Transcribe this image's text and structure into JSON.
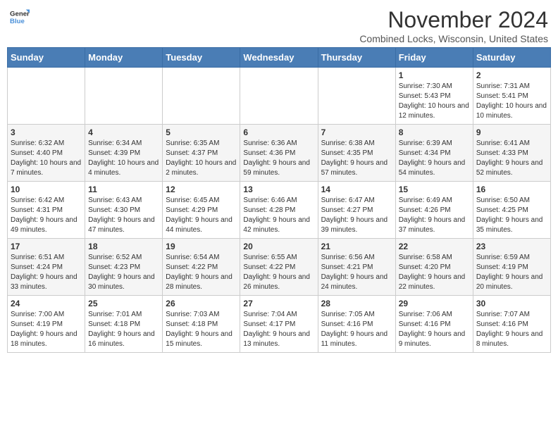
{
  "header": {
    "logo_line1": "General",
    "logo_line2": "Blue",
    "month_year": "November 2024",
    "location": "Combined Locks, Wisconsin, United States"
  },
  "days_of_week": [
    "Sunday",
    "Monday",
    "Tuesday",
    "Wednesday",
    "Thursday",
    "Friday",
    "Saturday"
  ],
  "weeks": [
    [
      {
        "day": "",
        "info": ""
      },
      {
        "day": "",
        "info": ""
      },
      {
        "day": "",
        "info": ""
      },
      {
        "day": "",
        "info": ""
      },
      {
        "day": "",
        "info": ""
      },
      {
        "day": "1",
        "info": "Sunrise: 7:30 AM\nSunset: 5:43 PM\nDaylight: 10 hours and 12 minutes."
      },
      {
        "day": "2",
        "info": "Sunrise: 7:31 AM\nSunset: 5:41 PM\nDaylight: 10 hours and 10 minutes."
      }
    ],
    [
      {
        "day": "3",
        "info": "Sunrise: 6:32 AM\nSunset: 4:40 PM\nDaylight: 10 hours and 7 minutes."
      },
      {
        "day": "4",
        "info": "Sunrise: 6:34 AM\nSunset: 4:39 PM\nDaylight: 10 hours and 4 minutes."
      },
      {
        "day": "5",
        "info": "Sunrise: 6:35 AM\nSunset: 4:37 PM\nDaylight: 10 hours and 2 minutes."
      },
      {
        "day": "6",
        "info": "Sunrise: 6:36 AM\nSunset: 4:36 PM\nDaylight: 9 hours and 59 minutes."
      },
      {
        "day": "7",
        "info": "Sunrise: 6:38 AM\nSunset: 4:35 PM\nDaylight: 9 hours and 57 minutes."
      },
      {
        "day": "8",
        "info": "Sunrise: 6:39 AM\nSunset: 4:34 PM\nDaylight: 9 hours and 54 minutes."
      },
      {
        "day": "9",
        "info": "Sunrise: 6:41 AM\nSunset: 4:33 PM\nDaylight: 9 hours and 52 minutes."
      }
    ],
    [
      {
        "day": "10",
        "info": "Sunrise: 6:42 AM\nSunset: 4:31 PM\nDaylight: 9 hours and 49 minutes."
      },
      {
        "day": "11",
        "info": "Sunrise: 6:43 AM\nSunset: 4:30 PM\nDaylight: 9 hours and 47 minutes."
      },
      {
        "day": "12",
        "info": "Sunrise: 6:45 AM\nSunset: 4:29 PM\nDaylight: 9 hours and 44 minutes."
      },
      {
        "day": "13",
        "info": "Sunrise: 6:46 AM\nSunset: 4:28 PM\nDaylight: 9 hours and 42 minutes."
      },
      {
        "day": "14",
        "info": "Sunrise: 6:47 AM\nSunset: 4:27 PM\nDaylight: 9 hours and 39 minutes."
      },
      {
        "day": "15",
        "info": "Sunrise: 6:49 AM\nSunset: 4:26 PM\nDaylight: 9 hours and 37 minutes."
      },
      {
        "day": "16",
        "info": "Sunrise: 6:50 AM\nSunset: 4:25 PM\nDaylight: 9 hours and 35 minutes."
      }
    ],
    [
      {
        "day": "17",
        "info": "Sunrise: 6:51 AM\nSunset: 4:24 PM\nDaylight: 9 hours and 33 minutes."
      },
      {
        "day": "18",
        "info": "Sunrise: 6:52 AM\nSunset: 4:23 PM\nDaylight: 9 hours and 30 minutes."
      },
      {
        "day": "19",
        "info": "Sunrise: 6:54 AM\nSunset: 4:22 PM\nDaylight: 9 hours and 28 minutes."
      },
      {
        "day": "20",
        "info": "Sunrise: 6:55 AM\nSunset: 4:22 PM\nDaylight: 9 hours and 26 minutes."
      },
      {
        "day": "21",
        "info": "Sunrise: 6:56 AM\nSunset: 4:21 PM\nDaylight: 9 hours and 24 minutes."
      },
      {
        "day": "22",
        "info": "Sunrise: 6:58 AM\nSunset: 4:20 PM\nDaylight: 9 hours and 22 minutes."
      },
      {
        "day": "23",
        "info": "Sunrise: 6:59 AM\nSunset: 4:19 PM\nDaylight: 9 hours and 20 minutes."
      }
    ],
    [
      {
        "day": "24",
        "info": "Sunrise: 7:00 AM\nSunset: 4:19 PM\nDaylight: 9 hours and 18 minutes."
      },
      {
        "day": "25",
        "info": "Sunrise: 7:01 AM\nSunset: 4:18 PM\nDaylight: 9 hours and 16 minutes."
      },
      {
        "day": "26",
        "info": "Sunrise: 7:03 AM\nSunset: 4:18 PM\nDaylight: 9 hours and 15 minutes."
      },
      {
        "day": "27",
        "info": "Sunrise: 7:04 AM\nSunset: 4:17 PM\nDaylight: 9 hours and 13 minutes."
      },
      {
        "day": "28",
        "info": "Sunrise: 7:05 AM\nSunset: 4:16 PM\nDaylight: 9 hours and 11 minutes."
      },
      {
        "day": "29",
        "info": "Sunrise: 7:06 AM\nSunset: 4:16 PM\nDaylight: 9 hours and 9 minutes."
      },
      {
        "day": "30",
        "info": "Sunrise: 7:07 AM\nSunset: 4:16 PM\nDaylight: 9 hours and 8 minutes."
      }
    ]
  ]
}
